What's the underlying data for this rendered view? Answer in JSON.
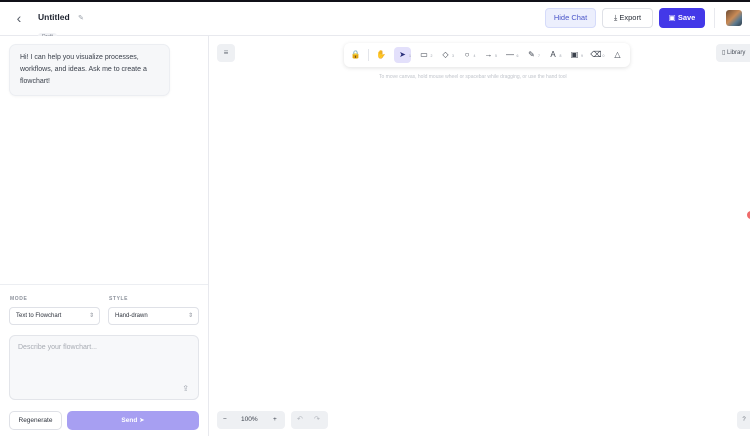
{
  "header": {
    "title": "Untitled",
    "badge": "Draft",
    "hide_chat_label": "Hide Chat",
    "export_label": "Export",
    "save_label": "Save",
    "accent_color": "#4338e8"
  },
  "chat": {
    "welcome_message": "Hi! I can help you visualize processes, workflows, and ideas. Ask me to create a flowchart!",
    "mode_label": "MODE",
    "mode_value": "Text to Flowchart",
    "style_label": "STYLE",
    "style_value": "Hand-drawn",
    "input_placeholder": "Describe your flowchart...",
    "regenerate_label": "Regenerate",
    "send_label": "Send"
  },
  "canvas": {
    "hint": "To move canvas, hold mouse wheel or spacebar while dragging, or use the hand tool",
    "library_label": "Library",
    "zoom_level": "100%",
    "tools": [
      {
        "name": "lock-icon",
        "glyph": "🔒",
        "key": ""
      },
      {
        "name": "hand-icon",
        "glyph": "✋",
        "key": ""
      },
      {
        "name": "pointer-icon",
        "glyph": "➤",
        "key": "1",
        "active": true
      },
      {
        "name": "rectangle-icon",
        "glyph": "▭",
        "key": "2"
      },
      {
        "name": "diamond-icon",
        "glyph": "◇",
        "key": "3"
      },
      {
        "name": "ellipse-icon",
        "glyph": "○",
        "key": "4"
      },
      {
        "name": "arrow-icon",
        "glyph": "→",
        "key": "5"
      },
      {
        "name": "line-icon",
        "glyph": "—",
        "key": "6"
      },
      {
        "name": "pencil-icon",
        "glyph": "✎",
        "key": "7"
      },
      {
        "name": "text-icon",
        "glyph": "A",
        "key": "8"
      },
      {
        "name": "image-icon",
        "glyph": "▣",
        "key": "9"
      },
      {
        "name": "eraser-icon",
        "glyph": "⌫",
        "key": "0"
      },
      {
        "name": "shapes-icon",
        "glyph": "△",
        "key": ""
      }
    ]
  }
}
